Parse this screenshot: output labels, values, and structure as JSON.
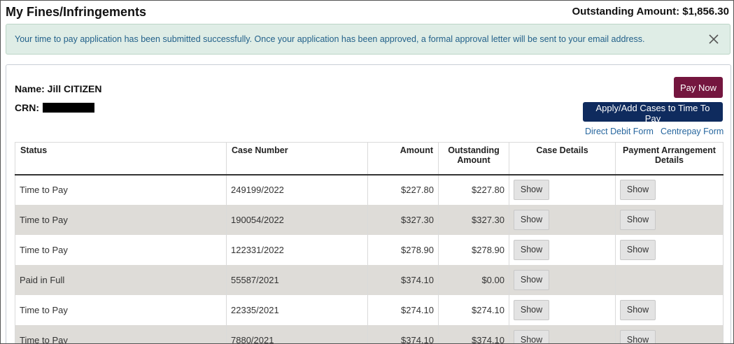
{
  "header": {
    "title": "My Fines/Infringements",
    "outstanding": "Outstanding Amount: $1,856.30"
  },
  "alert": {
    "message": "Your time to pay application has been submitted successfully. Once your application has been approved, a formal approval letter will be sent to your email address.",
    "close_icon": "close-icon"
  },
  "customer": {
    "name": "Name: Jill CITIZEN",
    "crn_label": "CRN:"
  },
  "actions": {
    "pay_now": "Pay Now",
    "apply": "Apply/Add Cases to Time To Pay",
    "direct_debit": "Direct Debit Form",
    "centrepay": "Centrepay Form"
  },
  "table": {
    "headers": {
      "status": "Status",
      "case_number": "Case Number",
      "amount": "Amount",
      "outstanding_1": "Outstanding",
      "outstanding_2": "Amount",
      "case_details": "Case Details",
      "payment_1": "Payment Arrangement",
      "payment_2": "Details"
    },
    "show_label": "Show",
    "rows": [
      {
        "status": "Time to Pay",
        "case": "249199/2022",
        "amount": "$227.80",
        "outstanding": "$227.80",
        "has_payment": true
      },
      {
        "status": "Time to Pay",
        "case": "190054/2022",
        "amount": "$327.30",
        "outstanding": "$327.30",
        "has_payment": true
      },
      {
        "status": "Time to Pay",
        "case": "122331/2022",
        "amount": "$278.90",
        "outstanding": "$278.90",
        "has_payment": true
      },
      {
        "status": "Paid in Full",
        "case": "55587/2021",
        "amount": "$374.10",
        "outstanding": "$0.00",
        "has_payment": false
      },
      {
        "status": "Time to Pay",
        "case": "22335/2021",
        "amount": "$274.10",
        "outstanding": "$274.10",
        "has_payment": true
      },
      {
        "status": "Time to Pay",
        "case": "7880/2021",
        "amount": "$374.10",
        "outstanding": "$374.10",
        "has_payment": true
      }
    ]
  },
  "colors": {
    "pay_now_bg": "#74163f",
    "apply_bg": "#0f2b5e",
    "alert_bg": "#dfede6",
    "alert_text": "#23618a",
    "link": "#26669e",
    "row_alt": "#dedcd8"
  }
}
